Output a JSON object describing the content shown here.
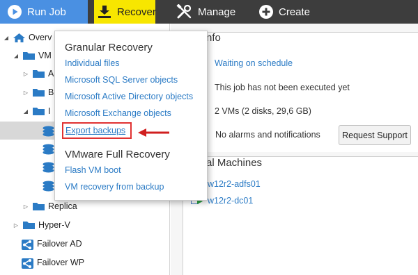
{
  "toolbar": {
    "run_job": "Run Job",
    "recover": "Recover",
    "manage": "Manage",
    "create": "Create"
  },
  "tree": {
    "items": [
      {
        "label": "Overv",
        "icon": "home-icon"
      },
      {
        "label": "VM",
        "icon": "folder-icon"
      },
      {
        "label": "A",
        "icon": "folder-icon"
      },
      {
        "label": "B",
        "icon": "folder-icon"
      },
      {
        "label": "I",
        "icon": "folder-icon"
      },
      {
        "label": "",
        "icon": "stack-icon"
      },
      {
        "label": "",
        "icon": "stack-icon"
      },
      {
        "label": "",
        "icon": "stack-icon"
      },
      {
        "label": "",
        "icon": "stack-icon"
      },
      {
        "label": "Replica",
        "icon": "folder-icon"
      },
      {
        "label": "Hyper-V",
        "icon": "folder-icon"
      },
      {
        "label": "Failover AD",
        "icon": "failover-icon"
      },
      {
        "label": "Failover WP",
        "icon": "failover-icon"
      }
    ]
  },
  "info": {
    "title": "nfo",
    "schedule": "Waiting on schedule",
    "executed": "This job has not been executed yet",
    "vms": "2 VMs (2 disks, 29,6 GB)",
    "alarms": "No alarms and notifications",
    "request_support": "Request Support"
  },
  "vms": {
    "title": "al Machines",
    "items": [
      "w12r2-adfs01",
      "w12r2-dc01"
    ]
  },
  "dropdown": {
    "granular_title": "Granular Recovery",
    "granular_items": [
      "Individual files",
      "Microsoft SQL Server objects",
      "Microsoft Active Directory objects",
      "Microsoft Exchange objects"
    ],
    "export_backups": "Export backups",
    "full_title": "VMware Full Recovery",
    "full_items": [
      "Flash VM boot",
      "VM recovery from backup"
    ]
  },
  "colors": {
    "toolbar_bg": "#3d3d3d",
    "run_job_bg": "#4a90e2",
    "recover_bg": "#f7e600",
    "link": "#2b7bc5",
    "highlight_red": "#e03131"
  }
}
